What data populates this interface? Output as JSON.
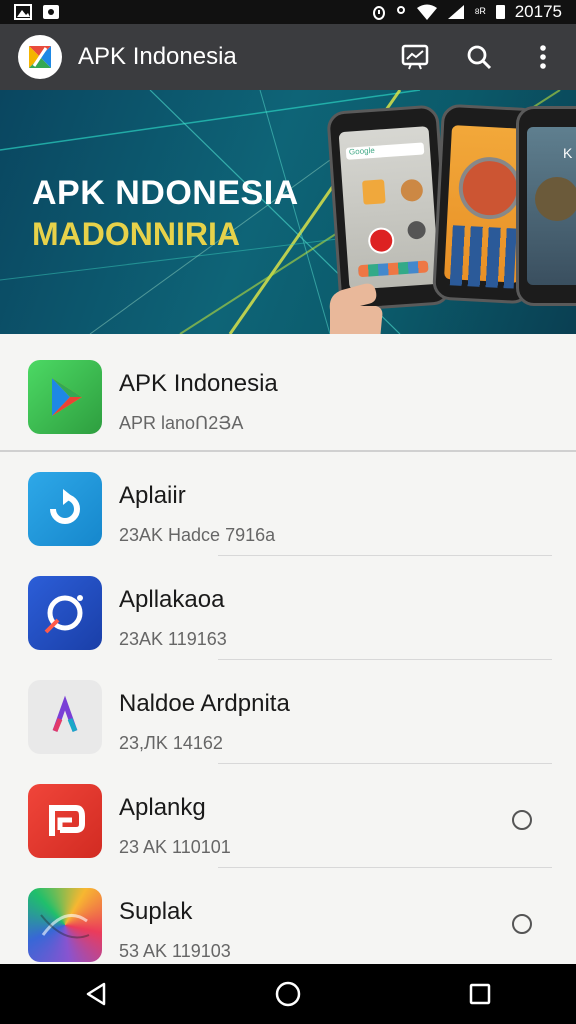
{
  "status_bar": {
    "time": "20175",
    "icons": [
      "image-icon",
      "cast-icon",
      "alarm-icon",
      "location-icon",
      "wifi-icon",
      "signal-icon",
      "battery-icon"
    ]
  },
  "app_bar": {
    "title": "APK Indonesia",
    "actions": [
      "slideshow-icon",
      "search-icon",
      "more-vert-icon"
    ]
  },
  "banner": {
    "line1": "APK NDONESIA",
    "line2": "MADONNIRIA",
    "phone_label": "Google",
    "side_label": "K"
  },
  "apps": [
    {
      "title": "APK Indonesia",
      "subtitle": "APR lanoՈ2ՅA",
      "icon": "play-store-icon",
      "radio": false
    },
    {
      "title": "Aplaiir",
      "subtitle": "23AK Hadce 7916a",
      "icon": "refresh-arrow-icon",
      "radio": false
    },
    {
      "title": "Apllakaoa",
      "subtitle": "23AK 119163",
      "icon": "compass-ring-icon",
      "radio": false
    },
    {
      "title": "Naldoe Ardpnita",
      "subtitle": "23,ЛK 14162",
      "icon": "lambda-icon",
      "radio": false
    },
    {
      "title": "Aplankg",
      "subtitle": "23 AK 110101",
      "icon": "flip-p-icon",
      "radio": true
    },
    {
      "title": "Suplak",
      "subtitle": "53 AK 119103",
      "icon": "swirl-icon",
      "radio": true
    }
  ],
  "colors": {
    "status_bar": "#111111",
    "app_bar": "#3b3c3f",
    "banner_bg": "#0e6477",
    "banner_accent": "#e7d24a",
    "nav_bar": "#000000"
  },
  "nav_bar": [
    "back-icon",
    "home-icon",
    "recents-icon"
  ]
}
